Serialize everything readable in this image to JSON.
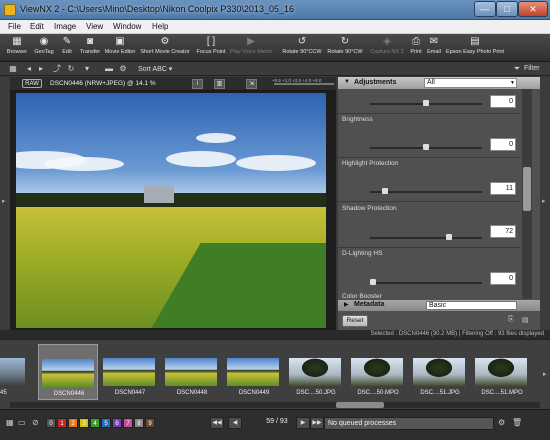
{
  "window": {
    "title": "ViewNX 2 - C:\\Users\\Mino\\Desktop\\Nikon Coolpix P330\\2013_05_16",
    "min_glyph": "—",
    "max_glyph": "□",
    "close_glyph": "✕"
  },
  "menu": [
    "File",
    "Edit",
    "Image",
    "View",
    "Window",
    "Help"
  ],
  "toolbar": [
    {
      "label": "Browser",
      "icon": "browser-icon",
      "glyph": "▦"
    },
    {
      "label": "GeoTag",
      "icon": "geotag-icon",
      "glyph": "◉"
    },
    {
      "label": "Edit",
      "icon": "edit-icon",
      "glyph": "✎"
    },
    {
      "label": "Transfer",
      "icon": "camera-icon",
      "glyph": "◙"
    },
    {
      "label": "Movie Editor",
      "icon": "movie-editor-icon",
      "glyph": "▣"
    },
    {
      "label": "Short Movie Creator",
      "icon": "movie-creator-icon",
      "glyph": "⚙"
    },
    {
      "label": "Focus Point",
      "icon": "focus-point-icon",
      "glyph": "[ ]"
    },
    {
      "label": "Play Voice Memo",
      "icon": "voice-memo-icon",
      "glyph": "▶",
      "disabled": true
    },
    {
      "label": "Rotate 90°CCW",
      "icon": "rotate-ccw-icon",
      "glyph": "↺"
    },
    {
      "label": "Rotate 90°CW",
      "icon": "rotate-cw-icon",
      "glyph": "↻"
    },
    {
      "label": "Capture NX 2",
      "icon": "capture-nx-icon",
      "glyph": "◈",
      "disabled": true
    },
    {
      "label": "Print",
      "icon": "print-icon",
      "glyph": "⎙"
    },
    {
      "label": "Email",
      "icon": "email-icon",
      "glyph": "✉"
    },
    {
      "label": "Epson Easy Photo Print",
      "icon": "epson-print-icon",
      "glyph": "▤"
    }
  ],
  "subtoolbar": {
    "sort_label": "Sort ABC",
    "sort_arrow": "▾",
    "filter_label": "Filter"
  },
  "viewer": {
    "raw_badge": "RAW",
    "file_title": "DSCN0446 (NRW+JPEG) @ 14.1 %",
    "info_glyph": "i",
    "zoom_ticks": "+0.5 +1.0 +2.0 +4.0 +8.0"
  },
  "adjustments": {
    "header": "Adjustments",
    "filter_value": "All",
    "rows": [
      {
        "label": "",
        "value": "0",
        "position": 0.5
      },
      {
        "label": "Brightness",
        "value": "0",
        "position": 0.5
      },
      {
        "label": "Highlight Protection",
        "value": "11",
        "position": 0.11
      },
      {
        "label": "Shadow Protection",
        "value": "72",
        "position": 0.72
      },
      {
        "label": "D-Lighting HS",
        "value": "0",
        "position": 0.0
      }
    ],
    "color_booster_label": "Color Booster"
  },
  "metadata": {
    "header": "Metadata",
    "value": "Basic",
    "reset_label": "Reset"
  },
  "status": {
    "selection_text": "Selected : DSCN0446 (30.2 MB) | Filtering Off : 93 files displayed"
  },
  "filmstrip": {
    "thumbs": [
      {
        "caption": "0445",
        "kind": "street"
      },
      {
        "caption": "DSCN0446",
        "kind": "field",
        "selected": true
      },
      {
        "caption": "DSCN0447",
        "kind": "field"
      },
      {
        "caption": "DSCN0448",
        "kind": "field"
      },
      {
        "caption": "DSCN0449",
        "kind": "field"
      },
      {
        "caption": "DSC....50.JPG",
        "kind": "tree"
      },
      {
        "caption": "DSC....50.MPO",
        "kind": "tree"
      },
      {
        "caption": "DSC....51.JPG",
        "kind": "tree"
      },
      {
        "caption": "DSC....51.MPO",
        "kind": "tree"
      }
    ]
  },
  "bottom": {
    "labels": [
      "0",
      "1",
      "2",
      "3",
      "4",
      "5",
      "6",
      "7",
      "8",
      "9"
    ],
    "label_colors": [
      "#555555",
      "#c62828",
      "#e07b1a",
      "#d4c312",
      "#3f9b2e",
      "#1f6fc4",
      "#7b3fb3",
      "#c44f9f",
      "#8a8a8a",
      "#6b4a2b"
    ],
    "page_counter": "59 / 93",
    "queue_text": "No queued processes",
    "prev_glyph": "◀◀",
    "prev1_glyph": "◀",
    "next1_glyph": "▶",
    "next_glyph": "▶▶"
  }
}
